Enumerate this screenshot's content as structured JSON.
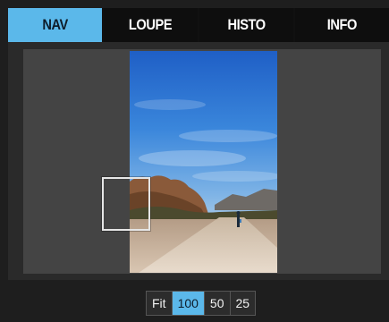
{
  "tabs": [
    {
      "label": "NAV",
      "active": true
    },
    {
      "label": "LOUPE",
      "active": false
    },
    {
      "label": "HISTO",
      "active": false
    },
    {
      "label": "INFO",
      "active": false
    }
  ],
  "navigator": {
    "image": "photo-desert-road-thumbnail",
    "viewport_frame": "zoom-viewport-rectangle"
  },
  "zoom": {
    "options": [
      "Fit",
      "100",
      "50",
      "25"
    ],
    "selected": "100"
  },
  "colors": {
    "accent": "#5bb8ea",
    "tab_inactive": "#0e0e0e",
    "canvas": "#444444",
    "panel_bg": "#1e1e1e"
  }
}
